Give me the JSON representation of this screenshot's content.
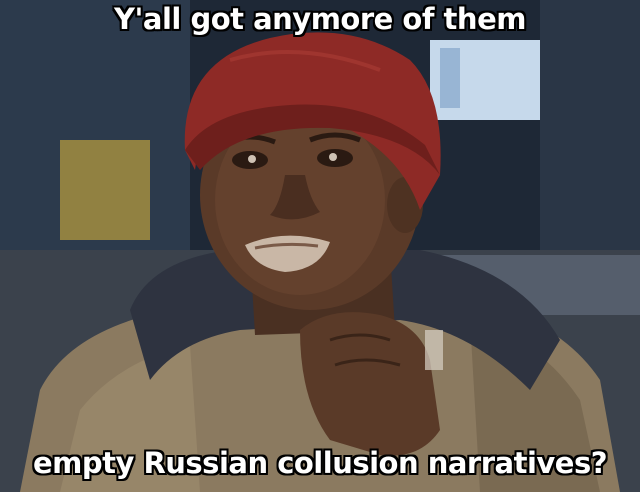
{
  "meme": {
    "top_text": "Y'all got anymore of them",
    "bottom_text": "empty Russian collusion narratives?"
  },
  "colors": {
    "beanie": "#8e2a26",
    "jacket": "#8b7a60",
    "hood": "#2e3340",
    "skin": "#5a3a28",
    "caption_fill": "#ffffff",
    "caption_stroke": "#000000"
  }
}
